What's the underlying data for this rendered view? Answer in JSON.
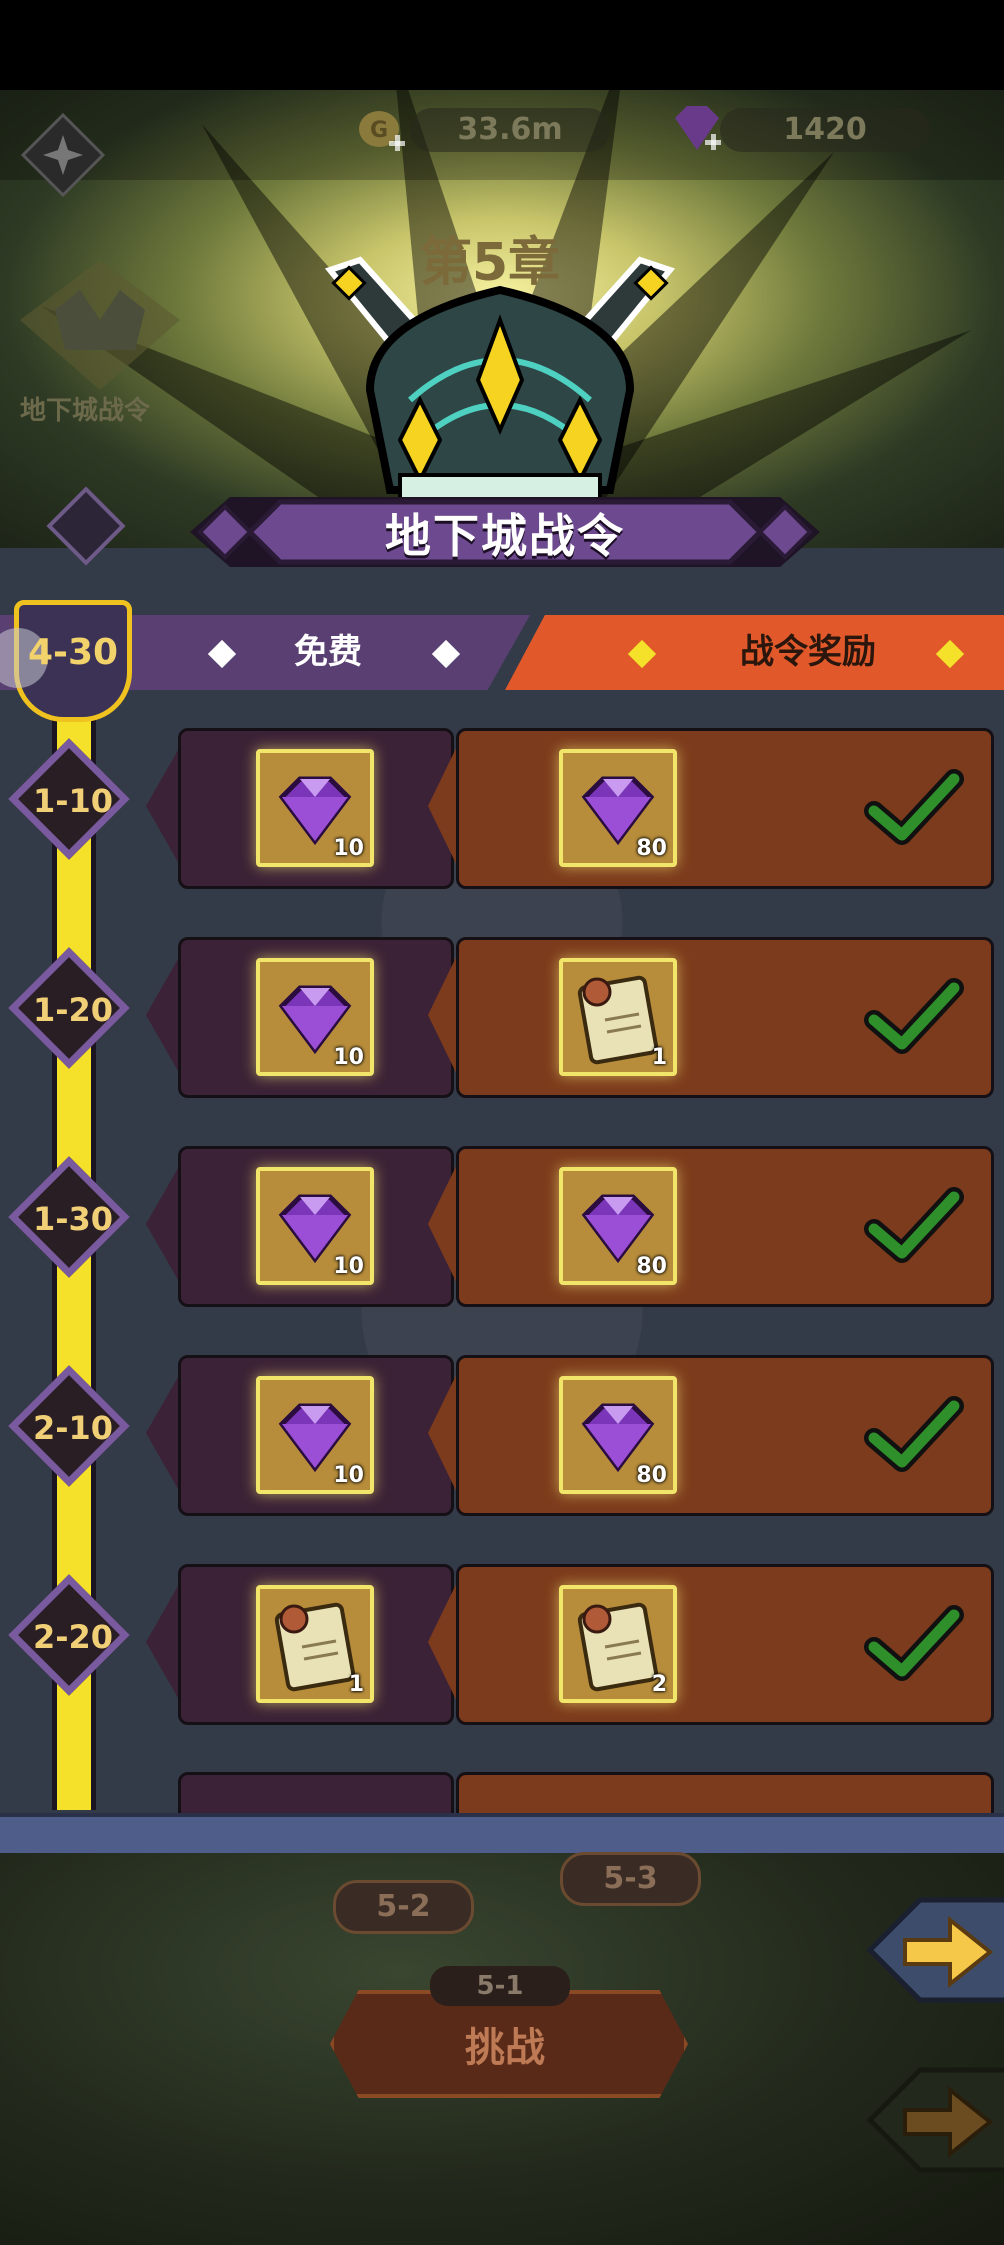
{
  "resources": {
    "gold": "33.6m",
    "gems": "1420"
  },
  "chapter": {
    "title": "第5章",
    "dungeon_pass_label": "地下城战令"
  },
  "banner": {
    "title": "地下城战令"
  },
  "header": {
    "current_level": "4-30",
    "free_label": "免费",
    "pass_label": "战令奖励"
  },
  "colors": {
    "free_color": "#5a3f72",
    "pass_color": "#e1592a",
    "track_color": "#f5e02a",
    "check_color": "#2f8f2a"
  },
  "rows": [
    {
      "level": "1-10",
      "free": {
        "icon": "purple-gem-icon",
        "qty": "10"
      },
      "pass": {
        "icon": "purple-gem-icon",
        "qty": "80"
      },
      "claimed": true
    },
    {
      "level": "1-20",
      "free": {
        "icon": "purple-gem-icon",
        "qty": "10"
      },
      "pass": {
        "icon": "scroll-icon",
        "qty": "1"
      },
      "claimed": true
    },
    {
      "level": "1-30",
      "free": {
        "icon": "purple-gem-icon",
        "qty": "10"
      },
      "pass": {
        "icon": "purple-gem-icon",
        "qty": "80"
      },
      "claimed": true
    },
    {
      "level": "2-10",
      "free": {
        "icon": "purple-gem-icon",
        "qty": "10"
      },
      "pass": {
        "icon": "purple-gem-icon",
        "qty": "80"
      },
      "claimed": true
    },
    {
      "level": "2-20",
      "free": {
        "icon": "scroll-icon",
        "qty": "1"
      },
      "pass": {
        "icon": "scroll-icon",
        "qty": "2"
      },
      "claimed": true
    }
  ],
  "stages": {
    "stage_a": "5-2",
    "stage_b": "5-3",
    "current": "5-1",
    "challenge_label": "挑战"
  }
}
